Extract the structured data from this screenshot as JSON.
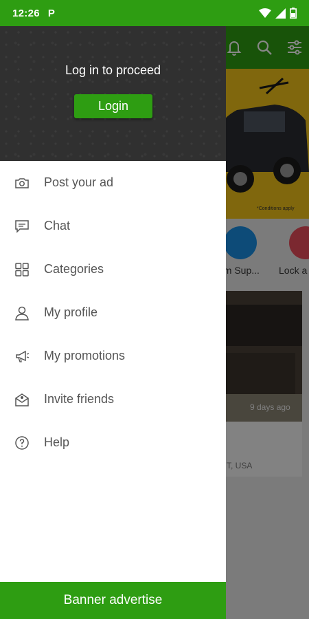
{
  "status_bar": {
    "time": "12:26",
    "notification": "P",
    "icons": [
      "wifi-icon",
      "signal-icon",
      "battery-icon"
    ]
  },
  "colors": {
    "brand_green": "#2e9d12",
    "drawer_header": "#303030",
    "menu_text": "#555555"
  },
  "background_app": {
    "header_icons": [
      "bell-icon",
      "search-icon",
      "filter-icon"
    ],
    "categories": [
      {
        "label": "om Sup...",
        "color": "#1a8fe3"
      },
      {
        "label": "Lock a",
        "color": "#e84d5b"
      }
    ],
    "listing": {
      "date": "9 days ago",
      "location": "T, USA"
    },
    "banner_note": "*Conditions apply"
  },
  "drawer": {
    "prompt": "Log in to proceed",
    "login_label": "Login",
    "menu": [
      {
        "label": "Post your ad",
        "icon": "camera-icon"
      },
      {
        "label": "Chat",
        "icon": "chat-icon"
      },
      {
        "label": "Categories",
        "icon": "grid-icon"
      },
      {
        "label": "My profile",
        "icon": "person-icon"
      },
      {
        "label": "My promotions",
        "icon": "megaphone-icon"
      },
      {
        "label": "Invite friends",
        "icon": "envelope-icon"
      },
      {
        "label": "Help",
        "icon": "help-icon"
      }
    ],
    "footer_label": "Banner advertise"
  }
}
